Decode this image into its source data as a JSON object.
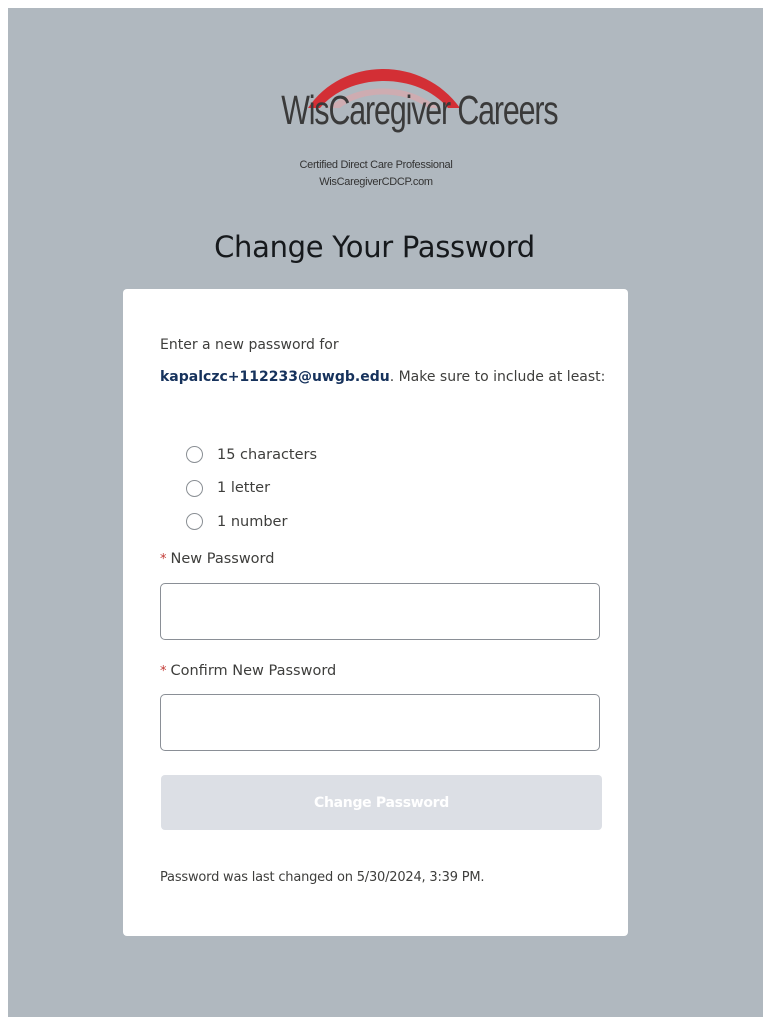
{
  "logo": {
    "title": "WisCaregiver Careers",
    "subtitle_line1": "Certified Direct Care Professional",
    "subtitle_line2": "WisCaregiverCDCP.com",
    "arc_color": "#d32f35"
  },
  "page": {
    "title": "Change Your Password",
    "background_color": "#b0b8bf"
  },
  "intro": {
    "prefix": "Enter a new password for",
    "email": "kapalczc+112233@uwgb.edu",
    "suffix": ". Make sure to include at least:"
  },
  "requirements": [
    {
      "label": "15 characters",
      "met": false
    },
    {
      "label": "1 letter",
      "met": false
    },
    {
      "label": "1 number",
      "met": false
    }
  ],
  "fields": {
    "new_password": {
      "required_marker": "*",
      "label": "New Password",
      "value": ""
    },
    "confirm_password": {
      "required_marker": "*",
      "label": "Confirm New Password",
      "value": ""
    }
  },
  "submit": {
    "label": "Change Password",
    "enabled": false
  },
  "footer": {
    "last_changed": "Password was last changed on 5/30/2024, 3:39 PM."
  }
}
